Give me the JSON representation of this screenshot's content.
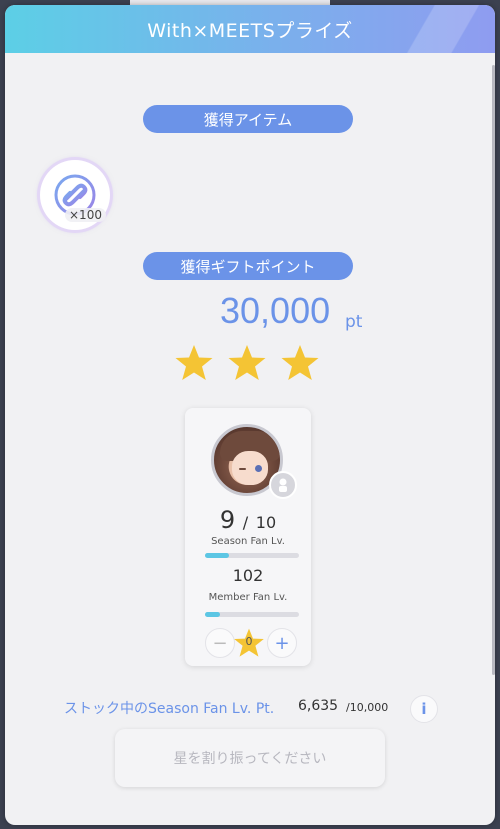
{
  "modal": {
    "title": "With×MEETSプライズ"
  },
  "items_section": {
    "heading": "獲得アイテム",
    "item": {
      "icon": "link-coin-icon",
      "count": "×100"
    }
  },
  "gift_section": {
    "heading": "獲得ギフトポイント",
    "points": "30,000",
    "unit": "pt",
    "stars_earned": 3
  },
  "member_card": {
    "season_lv_current": "9",
    "season_lv_sep": "/",
    "season_lv_max": "10",
    "season_lv_label": "Season Fan Lv.",
    "season_progress": 0.25,
    "member_lv": "102",
    "member_lv_label": "Member Fan Lv.",
    "member_progress": 0.16,
    "minus_label": "−",
    "plus_label": "+",
    "star_allocated": "0"
  },
  "stock": {
    "label": "ストック中のSeason Fan Lv. Pt.",
    "value": "6,635",
    "max": "/10,000",
    "info_label": "i"
  },
  "submit": {
    "label": "星を割り振ってください"
  },
  "colors": {
    "accent": "#6b93e8",
    "star": "#f4c434",
    "progress": "#5cc6e4"
  }
}
